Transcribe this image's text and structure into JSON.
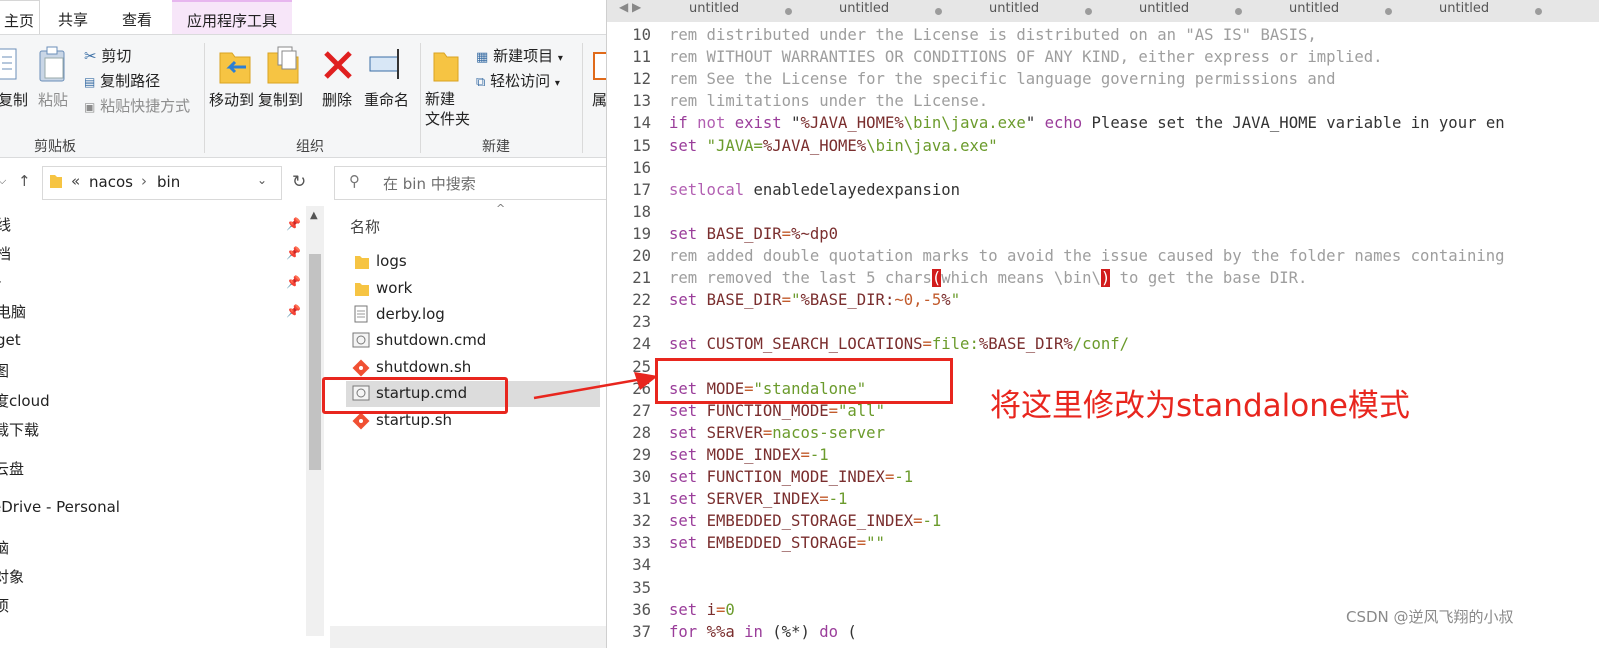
{
  "explorer": {
    "ribbon_tabs": [
      "主页",
      "共享",
      "查看",
      "应用程序工具"
    ],
    "clipboard": {
      "copy": "复制",
      "paste": "粘贴",
      "cut": "剪切",
      "copy_path": "复制路径",
      "paste_shortcut": "粘贴快捷方式",
      "label": "剪贴板"
    },
    "organize": {
      "move_to": "移动到",
      "copy_to": "复制到",
      "delete": "删除",
      "rename": "重命名",
      "label": "组织"
    },
    "new_group": {
      "new_folder": "新建\n文件夹",
      "new_item": "新建项目",
      "easy_access": "轻松访问",
      "label": "新建"
    },
    "properties_partial": "属",
    "address": {
      "prefix": "«",
      "parts": [
        "nacos",
        "bin"
      ]
    },
    "search_placeholder": "在 bin 中搜索",
    "column_header": "名称",
    "nav_items": [
      "线",
      "档",
      "-",
      "电脑",
      "get",
      "图",
      "度cloud",
      "载下载",
      "云盘",
      "eDrive - Personal",
      "脑",
      "对象",
      "项"
    ],
    "files": [
      {
        "name": "logs",
        "type": "folder"
      },
      {
        "name": "work",
        "type": "folder"
      },
      {
        "name": "derby.log",
        "type": "text"
      },
      {
        "name": "shutdown.cmd",
        "type": "cmd"
      },
      {
        "name": "shutdown.sh",
        "type": "sh"
      },
      {
        "name": "startup.cmd",
        "type": "cmd",
        "selected": true
      },
      {
        "name": "startup.sh",
        "type": "sh"
      }
    ]
  },
  "editor": {
    "tab_label": "untitled",
    "tab_count": 6,
    "lines": [
      {
        "n": "10",
        "t": [
          [
            "cm",
            "rem distributed under the License is distributed on an \"AS IS\" BASIS,"
          ]
        ]
      },
      {
        "n": "11",
        "t": [
          [
            "cm",
            "rem WITHOUT WARRANTIES OR CONDITIONS OF ANY KIND, either express or implied."
          ]
        ]
      },
      {
        "n": "12",
        "t": [
          [
            "cm",
            "rem See the License for the specific language governing permissions and"
          ]
        ]
      },
      {
        "n": "13",
        "t": [
          [
            "cm",
            "rem limitations under the License."
          ]
        ]
      },
      {
        "n": "14",
        "t": [
          [
            "k",
            "if "
          ],
          [
            "kc",
            "not "
          ],
          [
            "k",
            "exist "
          ],
          [
            "p",
            "\""
          ],
          [
            "v",
            "%JAVA_HOME%"
          ],
          [
            "s",
            "\\bin\\java.exe"
          ],
          [
            "p",
            "\" "
          ],
          [
            "k",
            "echo "
          ],
          [
            "p",
            "Please set the JAVA_HOME variable in your en"
          ]
        ]
      },
      {
        "n": "15",
        "t": [
          [
            "k",
            "set "
          ],
          [
            "s",
            "\"JAVA="
          ],
          [
            "v",
            "%JAVA_HOME%"
          ],
          [
            "s",
            "\\bin\\java.exe\""
          ]
        ]
      },
      {
        "n": "16",
        "t": []
      },
      {
        "n": "17",
        "t": [
          [
            "kc",
            "setlocal "
          ],
          [
            "p",
            "enabledelayedexpansion"
          ]
        ]
      },
      {
        "n": "18",
        "t": []
      },
      {
        "n": "19",
        "t": [
          [
            "k",
            "set "
          ],
          [
            "v",
            "BASE_DIR"
          ],
          [
            "o",
            "="
          ],
          [
            "v",
            "%~dp0"
          ]
        ]
      },
      {
        "n": "20",
        "t": [
          [
            "cm",
            "rem added double quotation marks to avoid the issue caused by the folder names containing"
          ]
        ]
      },
      {
        "n": "21",
        "t": [
          [
            "cm",
            "rem removed the last 5 chars"
          ],
          [
            "br",
            "("
          ],
          [
            "cm",
            "which means \\bin\\"
          ],
          [
            "br",
            ")"
          ],
          [
            "cm",
            " to get the base DIR."
          ]
        ]
      },
      {
        "n": "22",
        "t": [
          [
            "k",
            "set "
          ],
          [
            "v",
            "BASE_DIR"
          ],
          [
            "o",
            "="
          ],
          [
            "s",
            "\""
          ],
          [
            "v",
            "%BASE_DIR:"
          ],
          [
            "o",
            "~0,-5"
          ],
          [
            "v",
            "%"
          ],
          [
            "s",
            "\""
          ]
        ]
      },
      {
        "n": "23",
        "t": []
      },
      {
        "n": "24",
        "t": [
          [
            "k",
            "set "
          ],
          [
            "v",
            "CUSTOM_SEARCH_LOCATIONS"
          ],
          [
            "o",
            "="
          ],
          [
            "s",
            "file:"
          ],
          [
            "v",
            "%BASE_DIR%"
          ],
          [
            "s",
            "/conf/"
          ]
        ]
      },
      {
        "n": "25",
        "t": []
      },
      {
        "n": "26",
        "t": [
          [
            "k",
            "set "
          ],
          [
            "v",
            "MODE"
          ],
          [
            "o",
            "="
          ],
          [
            "s",
            "\"standalone\""
          ]
        ]
      },
      {
        "n": "27",
        "t": [
          [
            "k",
            "set "
          ],
          [
            "v",
            "FUNCTION_MODE"
          ],
          [
            "o",
            "="
          ],
          [
            "s",
            "\"all\""
          ]
        ]
      },
      {
        "n": "28",
        "t": [
          [
            "k",
            "set "
          ],
          [
            "v",
            "SERVER"
          ],
          [
            "o",
            "="
          ],
          [
            "s",
            "nacos-server"
          ]
        ]
      },
      {
        "n": "29",
        "t": [
          [
            "k",
            "set "
          ],
          [
            "v",
            "MODE_INDEX"
          ],
          [
            "o",
            "="
          ],
          [
            "s",
            "-1"
          ]
        ]
      },
      {
        "n": "30",
        "t": [
          [
            "k",
            "set "
          ],
          [
            "v",
            "FUNCTION_MODE_INDEX"
          ],
          [
            "o",
            "="
          ],
          [
            "s",
            "-1"
          ]
        ]
      },
      {
        "n": "31",
        "t": [
          [
            "k",
            "set "
          ],
          [
            "v",
            "SERVER_INDEX"
          ],
          [
            "o",
            "="
          ],
          [
            "s",
            "-1"
          ]
        ]
      },
      {
        "n": "32",
        "t": [
          [
            "k",
            "set "
          ],
          [
            "v",
            "EMBEDDED_STORAGE_INDEX"
          ],
          [
            "o",
            "="
          ],
          [
            "s",
            "-1"
          ]
        ]
      },
      {
        "n": "33",
        "t": [
          [
            "k",
            "set "
          ],
          [
            "v",
            "EMBEDDED_STORAGE"
          ],
          [
            "o",
            "="
          ],
          [
            "s",
            "\"\""
          ]
        ]
      },
      {
        "n": "34",
        "t": []
      },
      {
        "n": "35",
        "t": []
      },
      {
        "n": "36",
        "t": [
          [
            "k",
            "set "
          ],
          [
            "v",
            "i"
          ],
          [
            "o",
            "="
          ],
          [
            "s",
            "0"
          ]
        ]
      },
      {
        "n": "37",
        "t": [
          [
            "k",
            "for "
          ],
          [
            "v",
            "%%a "
          ],
          [
            "k",
            "in "
          ],
          [
            "p",
            "(%*) "
          ],
          [
            "k",
            "do "
          ],
          [
            "p",
            "("
          ]
        ]
      }
    ]
  },
  "annotation": "将这里修改为standalone模式",
  "watermark": "CSDN @逆风飞翔的小叔",
  "colors": {
    "annotation_red": "#e8261e",
    "selection_gray": "#dcdcdc"
  }
}
